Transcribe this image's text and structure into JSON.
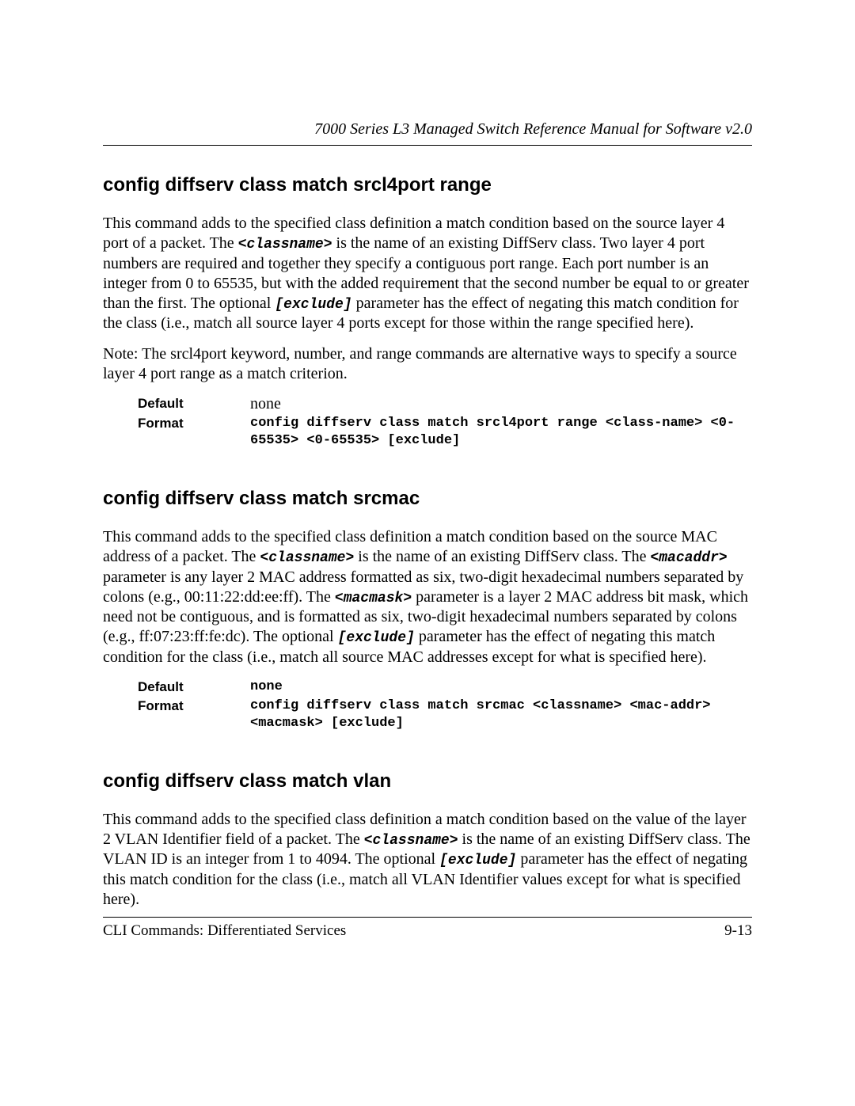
{
  "header": {
    "running": "7000 Series L3 Managed Switch Reference Manual for Software v2.0"
  },
  "sections": [
    {
      "heading": "config diffserv class match srcl4port range",
      "p1_a": "This command adds to the specified class definition a match condition based on the source layer 4 port of a packet. The ",
      "p1_param1": "<classname>",
      "p1_b": " is the name of an existing DiffServ class. Two layer 4 port numbers are required and together they specify a contiguous port range. Each port number is an integer from 0 to 65535, but with the added requirement that the second number be equal to or greater than the first. The optional ",
      "p1_param2": "[exclude]",
      "p1_c": " parameter has the effect of negating this match condition for the class (i.e., match all source layer 4 ports except for those within the range specified here).",
      "p2": "Note: The srcl4port keyword, number, and range commands are alternative ways to specify a source layer 4 port range as a match criterion.",
      "default_label": "Default",
      "default_value": "none",
      "format_label": "Format",
      "format_value": "config diffserv class match srcl4port range <class-name> <0-65535> <0-65535> [exclude]"
    },
    {
      "heading": "config diffserv class match srcmac",
      "p1_a": "This command adds to the specified class definition a match condition based on the source MAC address of a packet. The ",
      "p1_param1": "<classname>",
      "p1_b": " is the name of an existing DiffServ class. The ",
      "p1_param2": "<macaddr>",
      "p1_c": " parameter is any layer 2 MAC address formatted as six, two-digit hexadecimal numbers separated by colons (e.g., 00:11:22:dd:ee:ff). The ",
      "p1_param3": "<macmask>",
      "p1_d": " parameter is a layer 2 MAC address bit mask, which need not be contiguous, and is formatted as six, two-digit hexadecimal numbers separated by colons (e.g., ff:07:23:ff:fe:dc). The optional ",
      "p1_param4": "[exclude]",
      "p1_e": "  parameter has the effect of negating this match condition for the class (i.e., match all source MAC addresses except for what is specified here).",
      "default_label": "Default",
      "default_value": "none",
      "format_label": "Format",
      "format_value": "config diffserv class match srcmac <classname> <mac-addr> <macmask> [exclude]"
    },
    {
      "heading": "config diffserv class match vlan",
      "p1_a": "This command adds to the specified class definition a match condition based on the value of the layer 2 VLAN Identifier field of a packet. The ",
      "p1_param1": "<classname>",
      "p1_b": "  is the name of an existing DiffServ class. The VLAN ID is an integer from 1 to 4094. The optional ",
      "p1_param2": "[exclude]",
      "p1_c": "  parameter has the effect of negating this match condition for the class (i.e., match all VLAN Identifier values except for what is specified here)."
    }
  ],
  "footer": {
    "left": "CLI Commands: Differentiated Services",
    "right": "9-13"
  }
}
